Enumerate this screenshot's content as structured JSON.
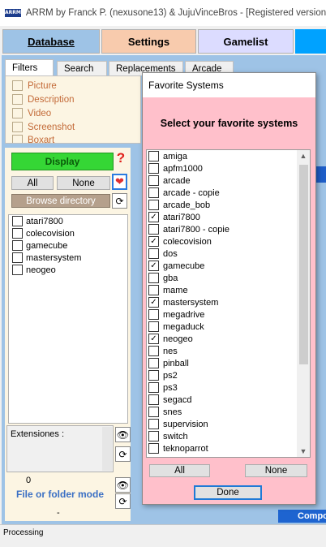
{
  "window": {
    "icon_text": "ARRM",
    "title": "ARRM by Franck P. (nexusone13) & JujuVinceBros - [Registered version"
  },
  "main_tabs": [
    {
      "label": "Database"
    },
    {
      "label": "Settings"
    },
    {
      "label": "Gamelist"
    }
  ],
  "sub_tabs": [
    {
      "label": "Filters"
    },
    {
      "label": "Search"
    },
    {
      "label": "Replacements"
    },
    {
      "label": "Arcade"
    }
  ],
  "filters": [
    {
      "label": "Picture",
      "checked": false
    },
    {
      "label": "Description",
      "checked": false
    },
    {
      "label": "Video",
      "checked": false
    },
    {
      "label": "Screenshot",
      "checked": false
    },
    {
      "label": "Boxart",
      "checked": false
    }
  ],
  "left_panel": {
    "display_label": "Display",
    "help_label": "?",
    "all_label": "All",
    "none_label": "None",
    "browse_label": "Browse directory",
    "systems": [
      {
        "name": "atari7800",
        "checked": false
      },
      {
        "name": "colecovision",
        "checked": false
      },
      {
        "name": "gamecube",
        "checked": false
      },
      {
        "name": "mastersystem",
        "checked": false
      },
      {
        "name": "neogeo",
        "checked": false
      }
    ],
    "extensions_label": "Extensiones :",
    "count": "0",
    "mode_label": "File or folder mode",
    "dash": "-"
  },
  "status": {
    "text": "Processing",
    "compose_label": "Compo"
  },
  "dialog": {
    "title": "Favorite Systems",
    "header": "Select your favorite systems",
    "systems": [
      {
        "name": "amiga",
        "checked": false
      },
      {
        "name": "apfm1000",
        "checked": false
      },
      {
        "name": "arcade",
        "checked": false
      },
      {
        "name": "arcade - copie",
        "checked": false
      },
      {
        "name": "arcade_bob",
        "checked": false
      },
      {
        "name": "atari7800",
        "checked": true
      },
      {
        "name": "atari7800 - copie",
        "checked": false
      },
      {
        "name": "colecovision",
        "checked": true
      },
      {
        "name": "dos",
        "checked": false
      },
      {
        "name": "gamecube",
        "checked": true
      },
      {
        "name": "gba",
        "checked": false
      },
      {
        "name": "mame",
        "checked": false
      },
      {
        "name": "mastersystem",
        "checked": true
      },
      {
        "name": "megadrive",
        "checked": false
      },
      {
        "name": "megaduck",
        "checked": false
      },
      {
        "name": "neogeo",
        "checked": true
      },
      {
        "name": "nes",
        "checked": false
      },
      {
        "name": "pinball",
        "checked": false
      },
      {
        "name": "ps2",
        "checked": false
      },
      {
        "name": "ps3",
        "checked": false
      },
      {
        "name": "segacd",
        "checked": false
      },
      {
        "name": "snes",
        "checked": false
      },
      {
        "name": "supervision",
        "checked": false
      },
      {
        "name": "switch",
        "checked": false
      },
      {
        "name": "teknoparrot",
        "checked": false
      }
    ],
    "all_label": "All",
    "none_label": "None",
    "done_label": "Done"
  },
  "icons": {
    "heart": "heart-icon",
    "refresh": "refresh-icon",
    "eye": "eye-icon",
    "scroll_up": "chevron-up-icon",
    "scroll_down": "chevron-down-icon"
  },
  "colors": {
    "tab_database": "#9ec3e6",
    "tab_settings": "#f8cbad",
    "tab_gamelist": "#dcdcff",
    "display_button": "#35d635",
    "dialog_body": "#ffc0cb",
    "accent_blue": "#1e64d0"
  }
}
